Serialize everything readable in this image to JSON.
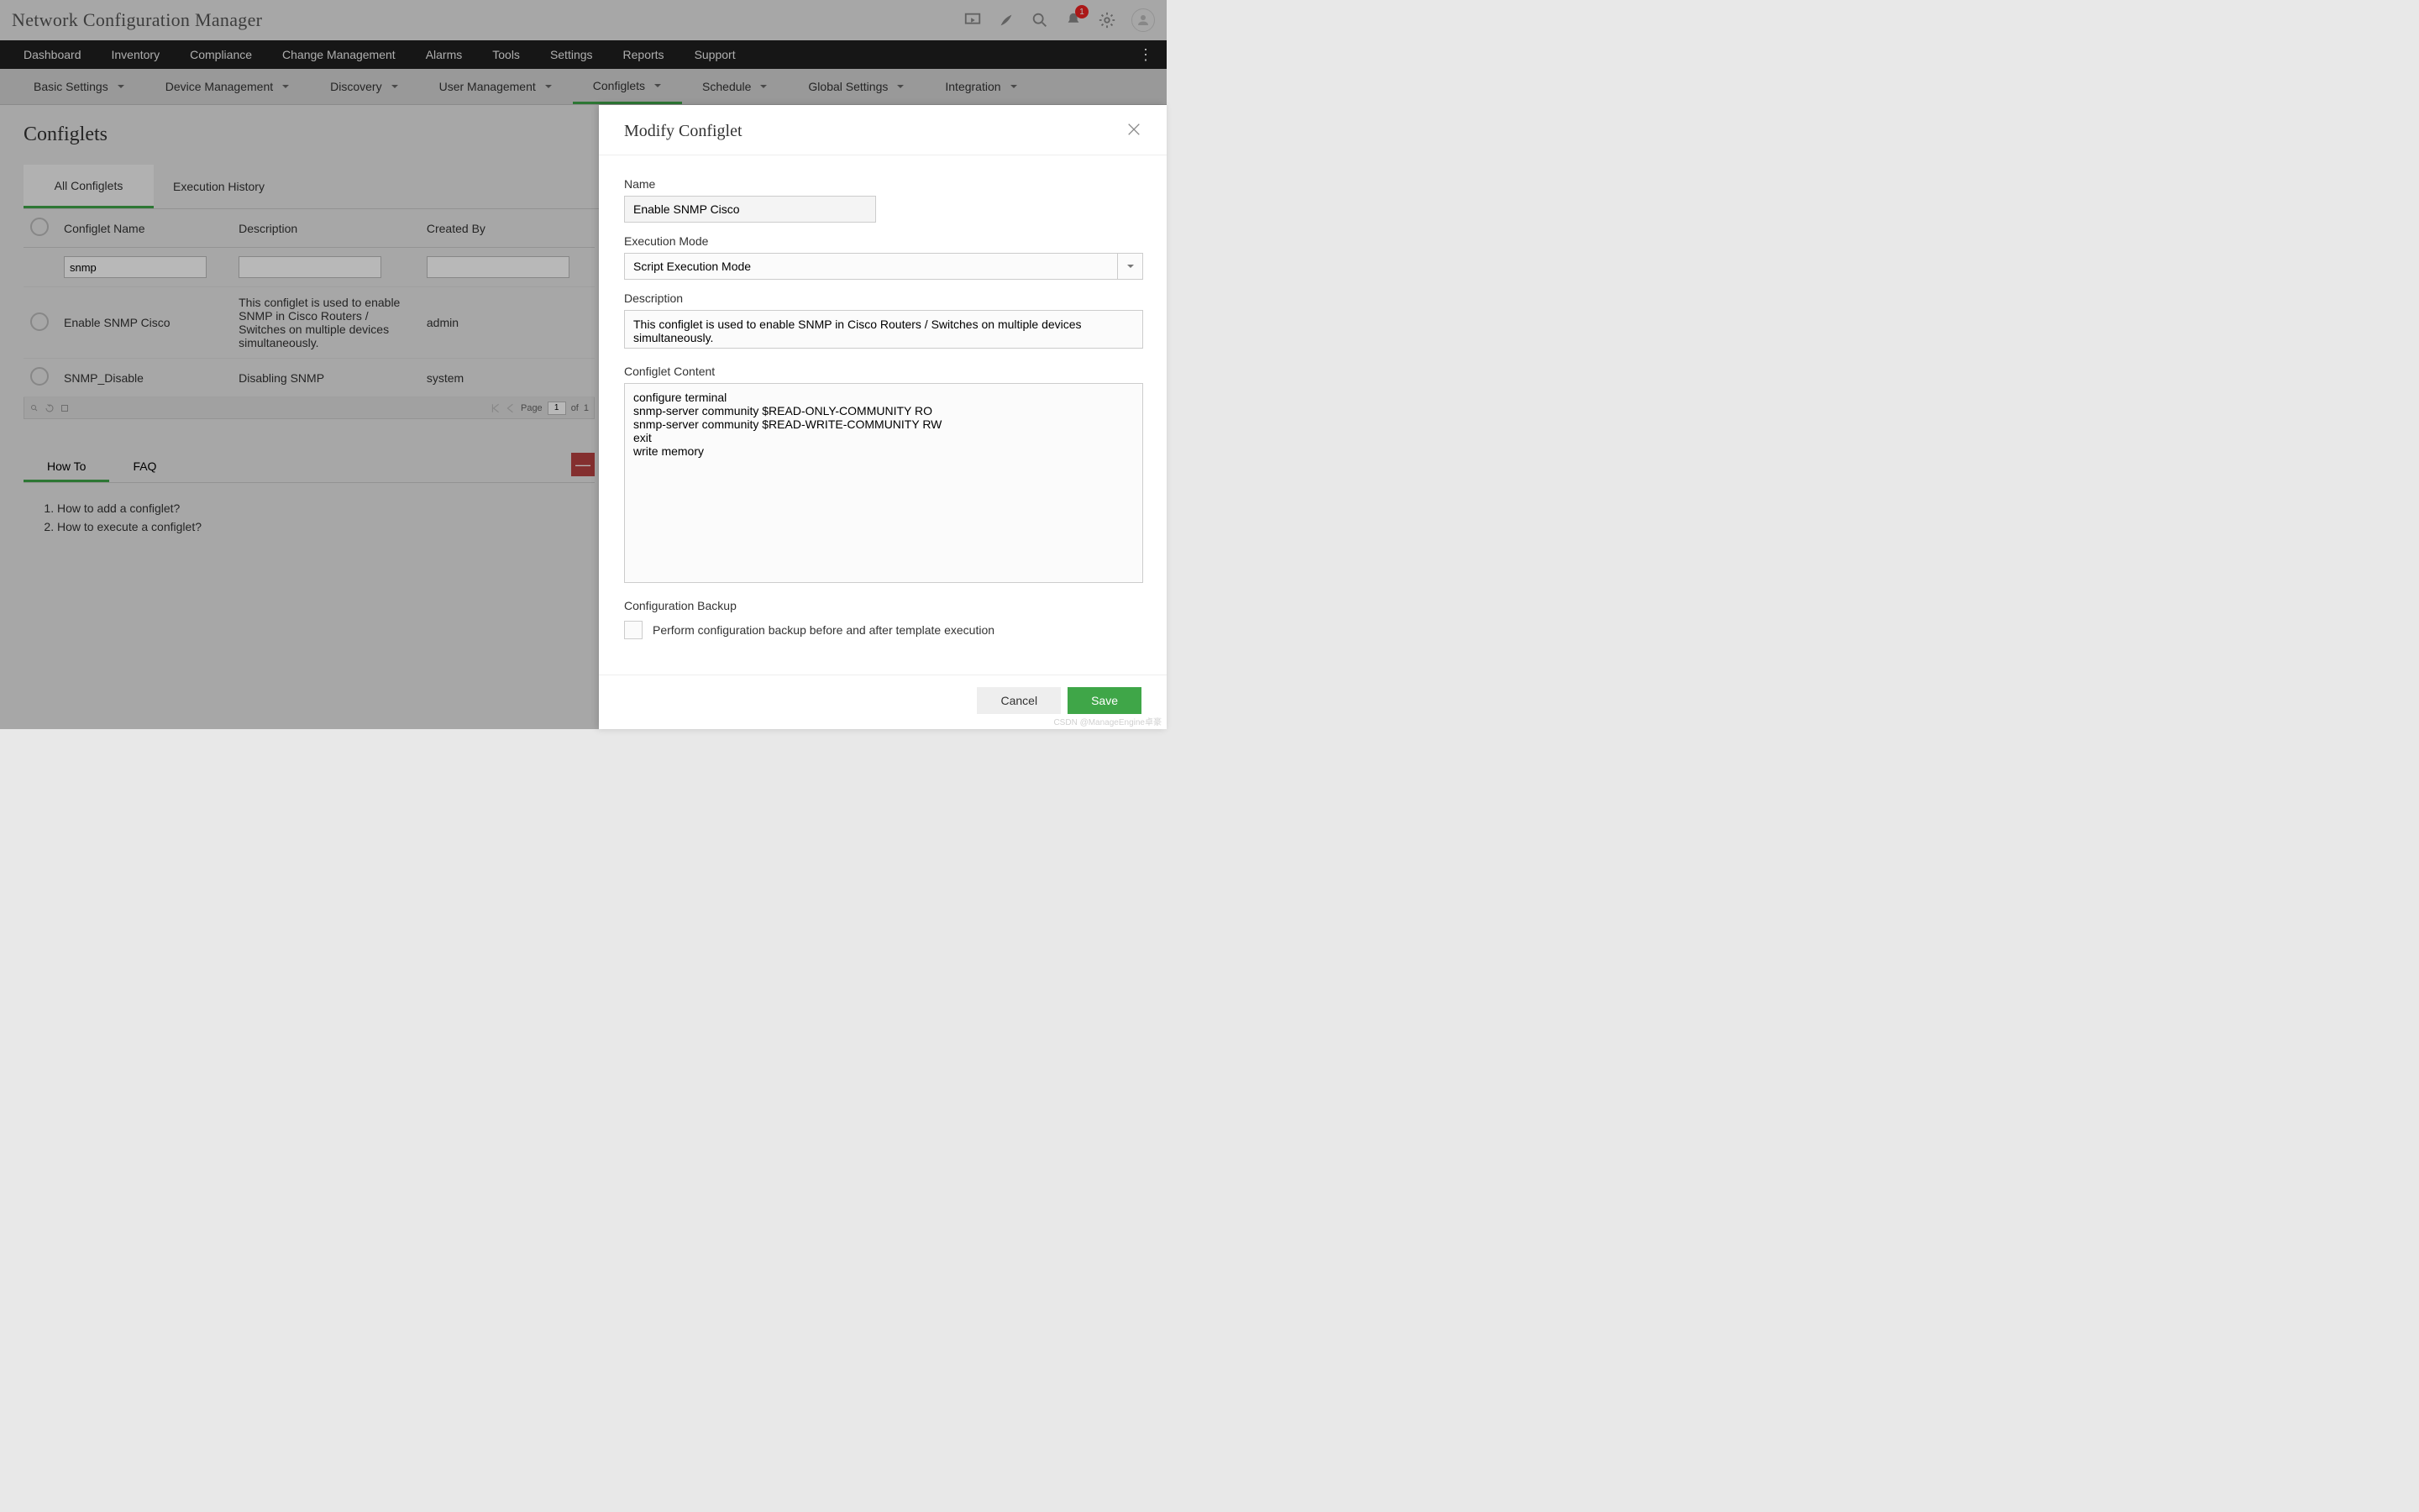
{
  "app": {
    "title": "Network Configuration Manager"
  },
  "notif": {
    "count": "1"
  },
  "mainnav": [
    "Dashboard",
    "Inventory",
    "Compliance",
    "Change Management",
    "Alarms",
    "Tools",
    "Settings",
    "Reports",
    "Support"
  ],
  "subnav": [
    {
      "label": "Basic Settings",
      "active": false
    },
    {
      "label": "Device Management",
      "active": false
    },
    {
      "label": "Discovery",
      "active": false
    },
    {
      "label": "User Management",
      "active": false
    },
    {
      "label": "Configlets",
      "active": true
    },
    {
      "label": "Schedule",
      "active": false
    },
    {
      "label": "Global Settings",
      "active": false
    },
    {
      "label": "Integration",
      "active": false
    }
  ],
  "page": {
    "title": "Configlets"
  },
  "tabs": {
    "all": "All Configlets",
    "history": "Execution History"
  },
  "table": {
    "headers": {
      "name": "Configlet Name",
      "desc": "Description",
      "by": "Created By"
    },
    "filter": {
      "name": "snmp",
      "desc": "",
      "by": ""
    },
    "rows": [
      {
        "name": "Enable SNMP Cisco",
        "desc": "This configlet is used to enable SNMP in Cisco Routers / Switches on multiple devices simultaneously.",
        "by": "admin"
      },
      {
        "name": "SNMP_Disable",
        "desc": "Disabling SNMP",
        "by": "system"
      }
    ],
    "pager": {
      "page_label": "Page",
      "page": "1",
      "of": "of",
      "total": "1"
    }
  },
  "help": {
    "tabs": {
      "howto": "How To",
      "faq": "FAQ"
    },
    "items": [
      "How to add a configlet?",
      "How to execute a configlet?"
    ]
  },
  "panel": {
    "title": "Modify Configlet",
    "name_label": "Name",
    "name_value": "Enable SNMP Cisco",
    "mode_label": "Execution Mode",
    "mode_value": "Script Execution Mode",
    "desc_label": "Description",
    "desc_value": "This configlet is used to enable SNMP in Cisco Routers / Switches on multiple devices simultaneously.",
    "content_label": "Configlet Content",
    "content_value": "configure terminal\nsnmp-server community $READ-ONLY-COMMUNITY RO\nsnmp-server community $READ-WRITE-COMMUNITY RW\nexit\nwrite memory",
    "backup_label": "Configuration Backup",
    "backup_cb": "Perform configuration backup before and after template execution",
    "cancel": "Cancel",
    "save": "Save"
  },
  "watermark": "CSDN @ManageEngine卓豪"
}
